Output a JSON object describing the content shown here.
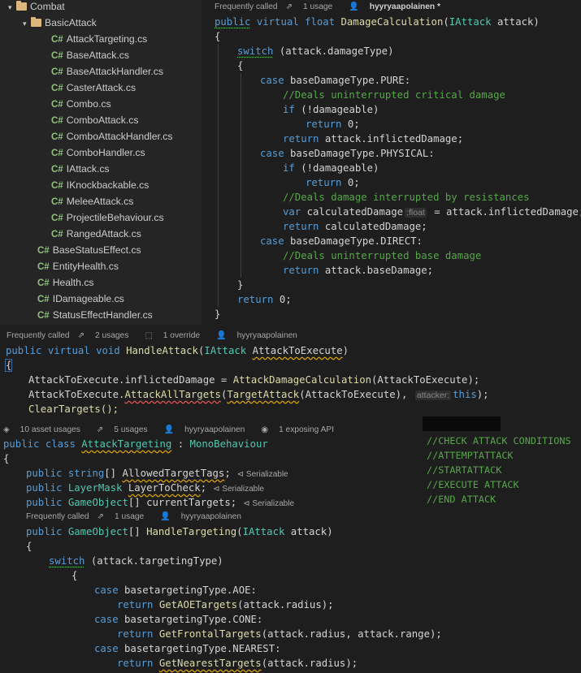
{
  "explorer": {
    "folders": [
      {
        "label": "Combat"
      },
      {
        "label": "BasicAttack"
      }
    ],
    "files_basic_attack": [
      "AttackTargeting.cs",
      "BaseAttack.cs",
      "BaseAttackHandler.cs",
      "CasterAttack.cs",
      "Combo.cs",
      "ComboAttack.cs",
      "ComboAttackHandler.cs",
      "ComboHandler.cs",
      "IAttack.cs",
      "IKnockbackable.cs",
      "MeleeAttack.cs",
      "ProjectileBehaviour.cs",
      "RangedAttack.cs"
    ],
    "files_combat": [
      "BaseStatusEffect.cs",
      "EntityHealth.cs",
      "Health.cs",
      "IDamageable.cs",
      "StatusEffectHandler.cs"
    ],
    "cs_badge": "C#"
  },
  "panel1": {
    "lens": {
      "frequently": "Frequently called",
      "usage": "1 usage",
      "author": "hyyryaapolainen *"
    },
    "signature": {
      "kw1": "public",
      "kw2": "virtual",
      "kw3": "float",
      "name": "DamageCalculation",
      "ptype": "IAttack",
      "pname": " attack)"
    },
    "switch_kw": "switch",
    "switch_expr": " (attack.damageType)",
    "case1": "baseDamageType.PURE:",
    "cm1": "//Deals uninterrupted critical damage",
    "if_expr": " (!damageable)",
    "ret0": " 0;",
    "ret_inflicted": " attack.inflictedDamage;",
    "case2": "baseDamageType.PHYSICAL:",
    "cm2": "//Deals damage interrupted by resistances",
    "var_line": " calculatedDamage",
    "var_hint": ":float",
    "var_rest": " = attack.inflictedDamage;",
    "ret_calc": " calculatedDamage;",
    "case3": "baseDamageType.DIRECT:",
    "cm3": "//Deals uninterrupted base damage",
    "ret_base": " attack.baseDamage;",
    "final_ret": " 0;"
  },
  "panel2": {
    "lens": {
      "frequently": "Frequently called",
      "usages": "2 usages",
      "override": "1 override",
      "author": "hyyryaapolainen"
    },
    "sig_name": "HandleAttack",
    "ptype": "IAttack",
    "pname": "AttackToExecute",
    "l1a": "AttackToExecute.inflictedDamage = ",
    "l1b": "AttackDamageCalculation",
    "l1c": "(AttackToExecute);",
    "l2a": "AttackToExecute.",
    "l2b": "AttackAllTargets",
    "l2c": "TargetAttack",
    "l2d": "(AttackToExecute), ",
    "l2hint": "attacker:",
    "l2e": "this",
    "l2f": ");",
    "l3": "ClearTargets();"
  },
  "panel3": {
    "lens": {
      "asset": "10 asset usages",
      "usages": "5 usages",
      "author": "hyyryaapolainen",
      "api": "1 exposing API"
    },
    "class_name": "AttackTargeting",
    "base_class": "MonoBehaviour",
    "f1_type": "string",
    "f1_name": "AllowedTargetTags",
    "f2_type": "LayerMask",
    "f2_name": "LayerToCheck",
    "f3_type": "GameObject",
    "f3_name": " currentTargets;",
    "serializable": "Serializable",
    "lens2": {
      "frequently": "Frequently called",
      "usage": "1 usage",
      "author": "hyyryaapolainen"
    },
    "m_type": "GameObject",
    "m_name": "HandleTargeting",
    "m_ptype": "IAttack",
    "m_pname": " attack)",
    "switch_expr": " (attack.targetingType)",
    "c1": "basetargetingType.AOE:",
    "r1a": "GetAOETargets",
    "r1b": "(attack.radius);",
    "c2": "basetargetingType.CONE:",
    "r2a": "GetFrontalTargets",
    "r2b": "(attack.radius, attack.range);",
    "c3": "basetargetingType.NEAREST:",
    "r3a": "GetNearestTargets",
    "r3b": "(attack.radius);"
  },
  "notes": [
    "//CHECK ATTACK CONDITIONS",
    "//ATTEMPTATTACK",
    "//STARTATTACK",
    "//EXECUTE ATTACK",
    "//END ATTACK"
  ],
  "colors": {
    "keyword": "#569cd6",
    "type": "#4ec9b0",
    "function": "#dcdcaa",
    "comment": "#57a64a",
    "background": "#1e1e1e"
  }
}
